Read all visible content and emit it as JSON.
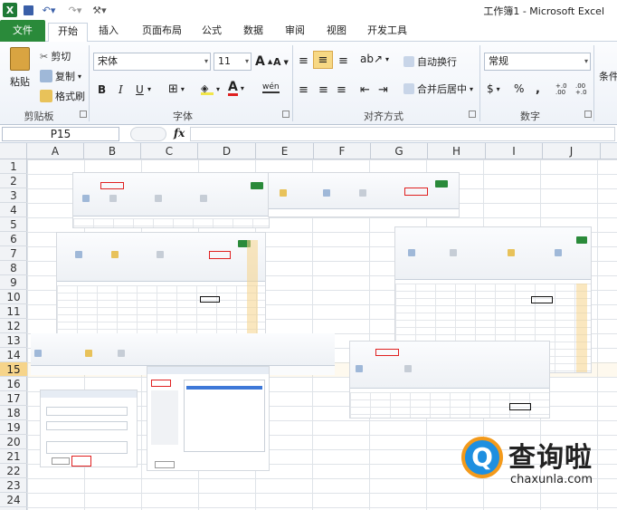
{
  "title": "工作簿1 - Microsoft Excel",
  "tabs": [
    "文件",
    "开始",
    "插入",
    "页面布局",
    "公式",
    "数据",
    "审阅",
    "视图",
    "开发工具"
  ],
  "active_tab": "开始",
  "clipboard": {
    "paste": "粘贴",
    "cut": "剪切",
    "copy": "复制",
    "format_painter": "格式刷",
    "group": "剪贴板"
  },
  "font": {
    "name": "宋体",
    "size": "11",
    "bold": "B",
    "italic": "I",
    "underline": "U",
    "group": "字体",
    "grow": "A",
    "shrink": "A",
    "font_color": "A",
    "phonetic": "wén"
  },
  "alignment": {
    "wrap": "自动换行",
    "merge": "合并后居中",
    "group": "对齐方式"
  },
  "number": {
    "format": "常规",
    "group": "数字",
    "percent": "%",
    "comma": ",",
    "increase_decimal": "+.0 .00",
    "decrease_decimal": ".00 +.0",
    "currency": "$"
  },
  "styles": {
    "conditional": "条件"
  },
  "namebox": "P15",
  "fx": "fx",
  "columns": [
    "A",
    "B",
    "C",
    "D",
    "E",
    "F",
    "G",
    "H",
    "I",
    "J"
  ],
  "rows": [
    "1",
    "2",
    "3",
    "4",
    "5",
    "6",
    "7",
    "8",
    "9",
    "10",
    "11",
    "12",
    "13",
    "14",
    "15",
    "16",
    "17",
    "18",
    "19",
    "20",
    "21",
    "22",
    "23",
    "24"
  ],
  "selected_row": "15",
  "watermark": {
    "cn": "查询啦",
    "en": "chaxunla.com",
    "mark": "Q"
  },
  "colors": {
    "file_tab": "#2a8a3a",
    "accent": "#f6d48a",
    "logo_blue": "#1e8fe0",
    "logo_orange": "#f39a1b"
  }
}
